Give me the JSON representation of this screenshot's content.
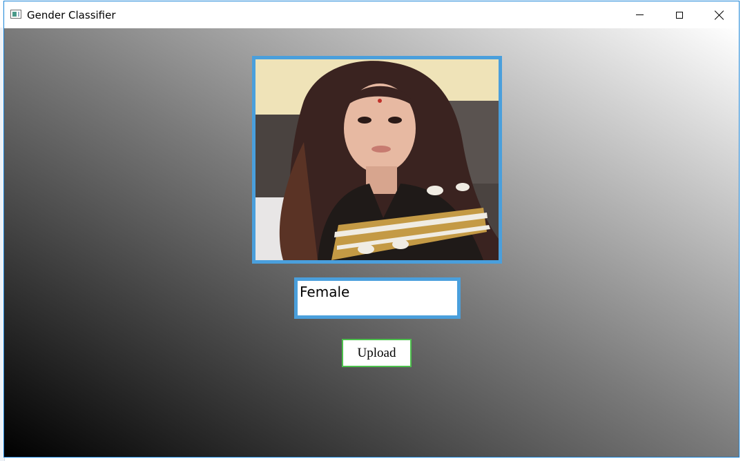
{
  "window": {
    "title": "Gender Classifier",
    "icon": "app-window-icon",
    "controls": {
      "minimize": "minimize-icon",
      "maximize": "maximize-icon",
      "close": "close-icon"
    }
  },
  "main": {
    "image": {
      "description_icon": "uploaded-face-photo"
    },
    "result": {
      "label": "Female"
    },
    "upload_button": {
      "label": "Upload"
    }
  },
  "colors": {
    "accent_border": "#4a9fdc",
    "button_border": "#4cc04c",
    "window_border": "#1883d7"
  }
}
